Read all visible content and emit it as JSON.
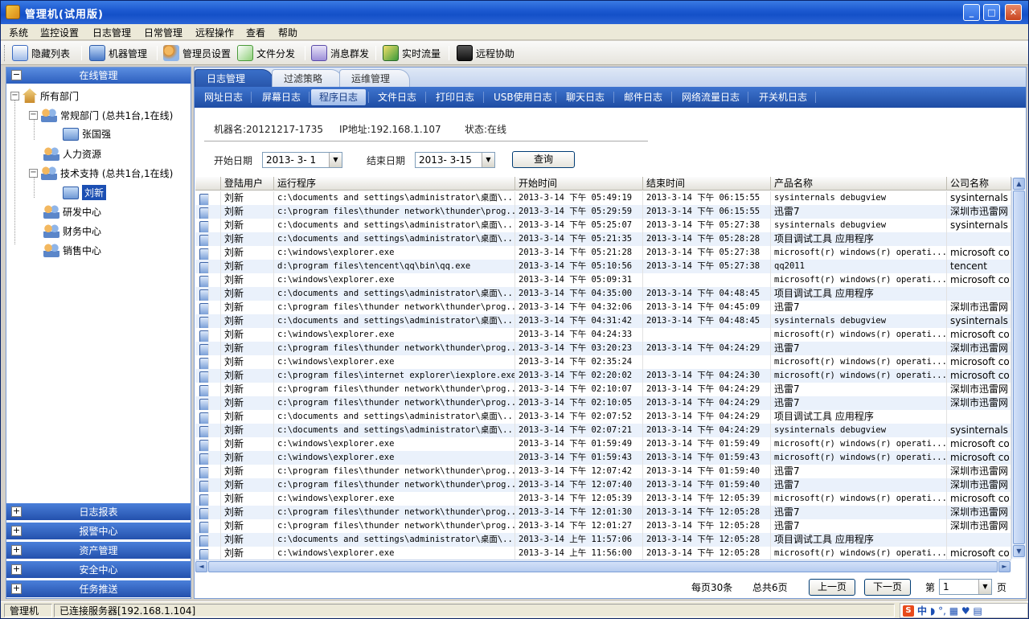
{
  "window": {
    "title": "管理机(试用版)",
    "min": "_",
    "max": "□",
    "close": "✕"
  },
  "menu": [
    "系统",
    "监控设置",
    "日志管理",
    "日常管理",
    "远程操作",
    "查看",
    "帮助"
  ],
  "toolbar": [
    {
      "label": "隐藏列表",
      "icon": "list-icon",
      "color": "#3b6bc1"
    },
    {
      "label": "机器管理",
      "icon": "computer-icon",
      "color": "#4a7ac8"
    },
    {
      "label": "管理员设置",
      "icon": "admin-users-icon",
      "color": "#d98b2a"
    },
    {
      "label": "文件分发",
      "icon": "file-distribute-icon",
      "color": "#4a9a3a"
    },
    {
      "label": "消息群发",
      "icon": "message-icon",
      "color": "#7a6bc1"
    },
    {
      "label": "实时流量",
      "icon": "traffic-icon",
      "color": "#3a9a3a"
    },
    {
      "label": "远程协助",
      "icon": "remote-icon",
      "color": "#333333"
    }
  ],
  "left": {
    "header": "在线管理",
    "header_btn": "−",
    "tree": {
      "root": "所有部门",
      "regular": "常规部门 (总共1台,1在线)",
      "user1": "张国强",
      "hr": "人力资源",
      "tech": "技术支持 (总共1台,1在线)",
      "user2": "刘新",
      "rd": "研发中心",
      "finance": "财务中心",
      "sales": "销售中心",
      "minus": "−"
    },
    "footer": [
      "日志报表",
      "报警中心",
      "资产管理",
      "安全中心",
      "任务推送"
    ],
    "footer_btn": "+"
  },
  "tabs": [
    "日志管理",
    "过滤策略",
    "运维管理"
  ],
  "subtabs": [
    "网址日志",
    "屏幕日志",
    "程序日志",
    "文件日志",
    "打印日志",
    "USB使用日志",
    "聊天日志",
    "邮件日志",
    "网络流量日志",
    "开关机日志"
  ],
  "info": {
    "machine": "机器名:20121217-1735",
    "ip": "IP地址:192.168.1.107",
    "status": "状态:在线"
  },
  "filter": {
    "start_label": "开始日期",
    "start": "2013- 3- 1",
    "end_label": "结束日期",
    "end": "2013- 3-15",
    "query": "查询",
    "arrow": "▼"
  },
  "columns": [
    "",
    "登陆用户",
    "运行程序",
    "开始时间",
    "结束时间",
    "产品名称",
    "公司名称"
  ],
  "rows": [
    [
      "刘新",
      "c:\\documents and settings\\administrator\\桌面\\...",
      "2013-3-14 下午 05:49:19",
      "2013-3-14 下午 06:15:55",
      "sysinternals debugview",
      "sysinternals"
    ],
    [
      "刘新",
      "c:\\program files\\thunder network\\thunder\\prog...",
      "2013-3-14 下午 05:29:59",
      "2013-3-14 下午 06:15:55",
      "迅雷7",
      "深圳市迅雷网"
    ],
    [
      "刘新",
      "c:\\documents and settings\\administrator\\桌面\\...",
      "2013-3-14 下午 05:25:07",
      "2013-3-14 下午 05:27:38",
      "sysinternals debugview",
      "sysinternals"
    ],
    [
      "刘新",
      "c:\\documents and settings\\administrator\\桌面\\...",
      "2013-3-14 下午 05:21:35",
      "2013-3-14 下午 05:28:28",
      "项目调试工具 应用程序",
      ""
    ],
    [
      "刘新",
      "c:\\windows\\explorer.exe",
      "2013-3-14 下午 05:21:28",
      "2013-3-14 下午 05:27:38",
      "microsoft(r) windows(r) operati...",
      "microsoft co"
    ],
    [
      "刘新",
      "d:\\program files\\tencent\\qq\\bin\\qq.exe",
      "2013-3-14 下午 05:10:56",
      "2013-3-14 下午 05:27:38",
      "qq2011",
      "tencent"
    ],
    [
      "刘新",
      "c:\\windows\\explorer.exe",
      "2013-3-14 下午 05:09:31",
      "",
      "microsoft(r) windows(r) operati...",
      "microsoft co"
    ],
    [
      "刘新",
      "c:\\documents and settings\\administrator\\桌面\\...",
      "2013-3-14 下午 04:35:00",
      "2013-3-14 下午 04:48:45",
      "项目调试工具 应用程序",
      ""
    ],
    [
      "刘新",
      "c:\\program files\\thunder network\\thunder\\prog...",
      "2013-3-14 下午 04:32:06",
      "2013-3-14 下午 04:45:09",
      "迅雷7",
      "深圳市迅雷网"
    ],
    [
      "刘新",
      "c:\\documents and settings\\administrator\\桌面\\...",
      "2013-3-14 下午 04:31:42",
      "2013-3-14 下午 04:48:45",
      "sysinternals debugview",
      "sysinternals"
    ],
    [
      "刘新",
      "c:\\windows\\explorer.exe",
      "2013-3-14 下午 04:24:33",
      "",
      "microsoft(r) windows(r) operati...",
      "microsoft co"
    ],
    [
      "刘新",
      "c:\\program files\\thunder network\\thunder\\prog...",
      "2013-3-14 下午 03:20:23",
      "2013-3-14 下午 04:24:29",
      "迅雷7",
      "深圳市迅雷网"
    ],
    [
      "刘新",
      "c:\\windows\\explorer.exe",
      "2013-3-14 下午 02:35:24",
      "",
      "microsoft(r) windows(r) operati...",
      "microsoft co"
    ],
    [
      "刘新",
      "c:\\program files\\internet explorer\\iexplore.exe",
      "2013-3-14 下午 02:20:02",
      "2013-3-14 下午 04:24:30",
      "microsoft(r) windows(r) operati...",
      "microsoft co"
    ],
    [
      "刘新",
      "c:\\program files\\thunder network\\thunder\\prog...",
      "2013-3-14 下午 02:10:07",
      "2013-3-14 下午 04:24:29",
      "迅雷7",
      "深圳市迅雷网"
    ],
    [
      "刘新",
      "c:\\program files\\thunder network\\thunder\\prog...",
      "2013-3-14 下午 02:10:05",
      "2013-3-14 下午 04:24:29",
      "迅雷7",
      "深圳市迅雷网"
    ],
    [
      "刘新",
      "c:\\documents and settings\\administrator\\桌面\\...",
      "2013-3-14 下午 02:07:52",
      "2013-3-14 下午 04:24:29",
      "项目调试工具 应用程序",
      ""
    ],
    [
      "刘新",
      "c:\\documents and settings\\administrator\\桌面\\...",
      "2013-3-14 下午 02:07:21",
      "2013-3-14 下午 04:24:29",
      "sysinternals debugview",
      "sysinternals"
    ],
    [
      "刘新",
      "c:\\windows\\explorer.exe",
      "2013-3-14 下午 01:59:49",
      "2013-3-14 下午 01:59:49",
      "microsoft(r) windows(r) operati...",
      "microsoft co"
    ],
    [
      "刘新",
      "c:\\windows\\explorer.exe",
      "2013-3-14 下午 01:59:43",
      "2013-3-14 下午 01:59:43",
      "microsoft(r) windows(r) operati...",
      "microsoft co"
    ],
    [
      "刘新",
      "c:\\program files\\thunder network\\thunder\\prog...",
      "2013-3-14 下午 12:07:42",
      "2013-3-14 下午 01:59:40",
      "迅雷7",
      "深圳市迅雷网"
    ],
    [
      "刘新",
      "c:\\program files\\thunder network\\thunder\\prog...",
      "2013-3-14 下午 12:07:40",
      "2013-3-14 下午 01:59:40",
      "迅雷7",
      "深圳市迅雷网"
    ],
    [
      "刘新",
      "c:\\windows\\explorer.exe",
      "2013-3-14 下午 12:05:39",
      "2013-3-14 下午 12:05:39",
      "microsoft(r) windows(r) operati...",
      "microsoft co"
    ],
    [
      "刘新",
      "c:\\program files\\thunder network\\thunder\\prog...",
      "2013-3-14 下午 12:01:30",
      "2013-3-14 下午 12:05:28",
      "迅雷7",
      "深圳市迅雷网"
    ],
    [
      "刘新",
      "c:\\program files\\thunder network\\thunder\\prog...",
      "2013-3-14 下午 12:01:27",
      "2013-3-14 下午 12:05:28",
      "迅雷7",
      "深圳市迅雷网"
    ],
    [
      "刘新",
      "c:\\documents and settings\\administrator\\桌面\\...",
      "2013-3-14 上午 11:57:06",
      "2013-3-14 下午 12:05:28",
      "项目调试工具 应用程序",
      ""
    ],
    [
      "刘新",
      "c:\\windows\\explorer.exe",
      "2013-3-14 上午 11:56:00",
      "2013-3-14 下午 12:05:28",
      "microsoft(r) windows(r) operati...",
      "microsoft co"
    ]
  ],
  "pager": {
    "per_page": "每页30条",
    "total": "总共6页",
    "prev": "上一页",
    "next": "下一页",
    "page_label": "第",
    "page": "1",
    "page_suffix": "页"
  },
  "scroll": {
    "up": "▲",
    "down": "▼",
    "left": "◄",
    "right": "►"
  },
  "status": {
    "app": "管理机",
    "server": "已连接服务器[192.168.1.104]"
  },
  "ime": {
    "logo": "S",
    "mode": "中",
    "glyphs": "◗ °, ▦ ♥ ▤"
  }
}
